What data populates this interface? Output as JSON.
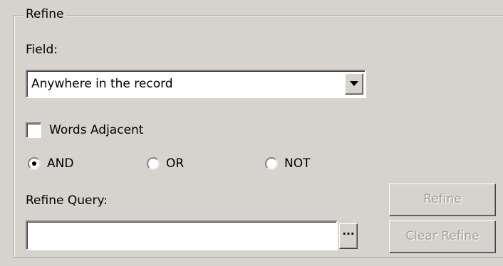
{
  "group": {
    "title": "Refine"
  },
  "field": {
    "label": "Field:",
    "selected_value": "Anywhere in the record"
  },
  "words_adjacent": {
    "label": "Words Adjacent",
    "checked": false
  },
  "operators": [
    {
      "label": "AND",
      "selected": true
    },
    {
      "label": "OR",
      "selected": false
    },
    {
      "label": "NOT",
      "selected": false
    }
  ],
  "refine_query": {
    "label": "Refine Query:",
    "value": "",
    "browse_label": "···"
  },
  "buttons": {
    "refine_label": "Refine",
    "clear_refine_label": "Clear Refine",
    "enabled": false
  },
  "colors": {
    "panel_background": "#d6d3ce",
    "disabled_text": "#a5a29c"
  }
}
